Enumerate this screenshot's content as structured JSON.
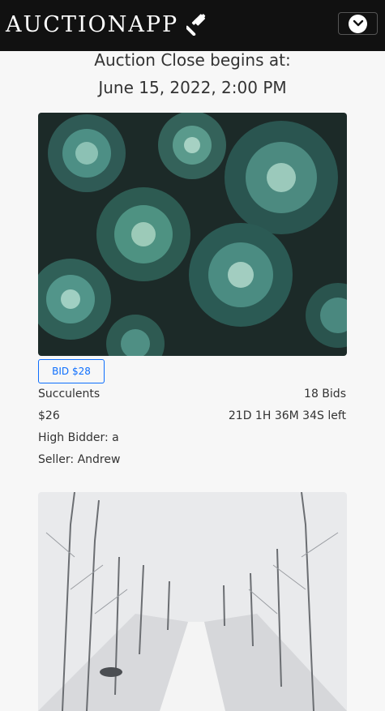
{
  "navbar": {
    "brand": "AUCTIONAPP",
    "brand_icon": "gavel-icon",
    "toggle_icon": "chevron-down-circle-icon"
  },
  "auction": {
    "close_heading": "Auction Close begins at:",
    "close_date": "June 15, 2022, 2:00 PM"
  },
  "items": [
    {
      "image": "succulents-photo",
      "bid_label": "BID $28",
      "name": "Succulents",
      "price": "$26",
      "high_bidder": "High Bidder: a",
      "seller": "Seller: Andrew",
      "bids": "18 Bids",
      "time_left": "21D 1H 36M 34S left"
    },
    {
      "image": "snowy-road-photo"
    }
  ],
  "colors": {
    "navbar_bg": "#111111",
    "accent": "#0d6efd",
    "background": "#f7f7f7"
  }
}
